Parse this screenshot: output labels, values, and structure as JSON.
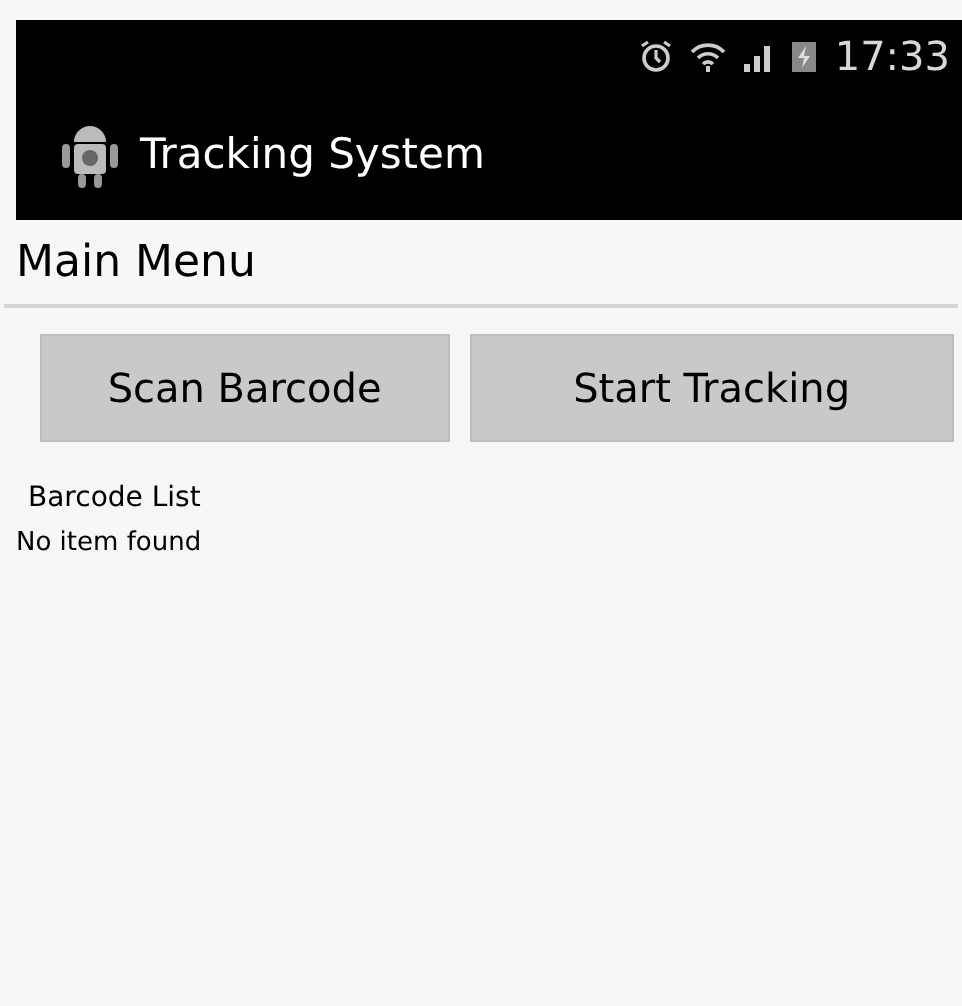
{
  "status_bar": {
    "time": "17:33"
  },
  "action_bar": {
    "title": "Tracking System"
  },
  "screen_title": "Main Menu",
  "buttons": [
    "Scan Barcode",
    "Start Tracking"
  ],
  "list": {
    "label": "Barcode List",
    "empty_text": "No item found"
  }
}
